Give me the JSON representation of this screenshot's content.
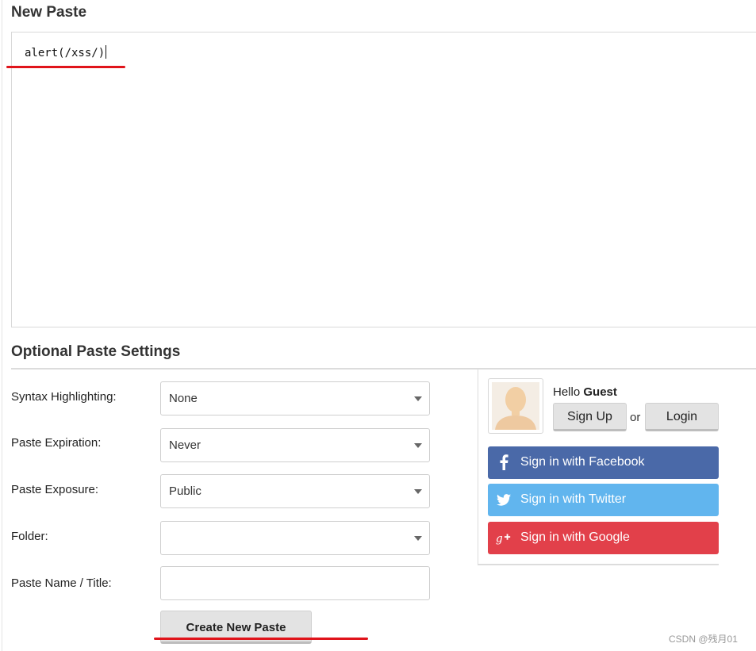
{
  "page": {
    "title": "New Paste"
  },
  "editor": {
    "content": "alert(/xss/)"
  },
  "settings": {
    "title": "Optional Paste Settings",
    "syntax": {
      "label": "Syntax Highlighting:",
      "value": "None"
    },
    "expiration": {
      "label": "Paste Expiration:",
      "value": "Never"
    },
    "exposure": {
      "label": "Paste Exposure:",
      "value": "Public"
    },
    "folder": {
      "label": "Folder:",
      "value": ""
    },
    "name": {
      "label": "Paste Name / Title:",
      "value": ""
    },
    "submit_label": "Create New Paste"
  },
  "guest": {
    "hello_prefix": "Hello",
    "hello_name": "Guest",
    "signup_label": "Sign Up",
    "or_text": "or",
    "login_label": "Login",
    "facebook_label": "Sign in with Facebook",
    "twitter_label": "Sign in with Twitter",
    "google_label": "Sign in with Google",
    "facebook_color": "#4a69a8",
    "twitter_color": "#61b5ee",
    "google_color": "#e2404a"
  },
  "watermark": "CSDN @残月01",
  "annotation_color": "#e0141b"
}
